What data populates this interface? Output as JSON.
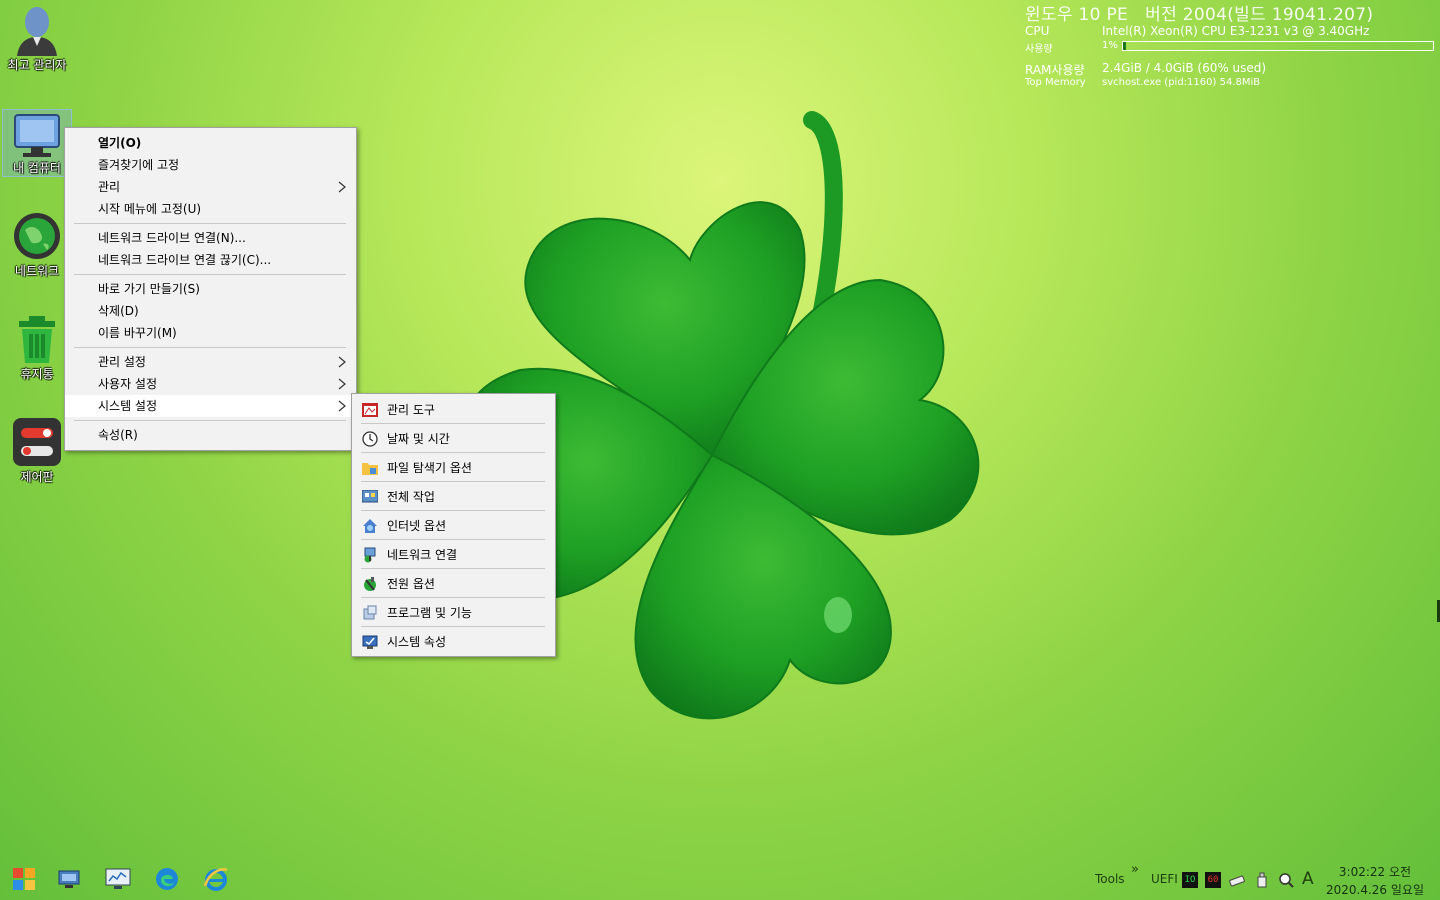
{
  "desktop": {
    "icons": [
      {
        "label": "최고 관리자",
        "icon": "admin-user-icon"
      },
      {
        "label": "내 컴퓨터",
        "icon": "my-computer-icon"
      },
      {
        "label": "네트워크",
        "icon": "network-globe-icon"
      },
      {
        "label": "휴지통",
        "icon": "recycle-bin-icon"
      },
      {
        "label": "제어판",
        "icon": "control-panel-icon"
      }
    ]
  },
  "sysinfo": {
    "title": "윈도우 10 PE   버전 2004(빌드 19041.207)",
    "cpu_label": "CPU",
    "cpu_value": "Intel(R) Xeon(R) CPU E3-1231 v3 @ 3.40GHz",
    "usage_label": "사용량",
    "usage_value": "1%",
    "usage_fraction": 0.01,
    "ram_label": "RAM사용량",
    "ram_value": "2.4GiB / 4.0GiB (60% used)",
    "topmem_label": "Top Memory",
    "topmem_value": "svchost.exe (pid:1160) 54.8MiB"
  },
  "context_menu": {
    "items": [
      {
        "label": "열기(O)"
      },
      {
        "label": "즐겨찾기에 고정"
      },
      {
        "label": "관리"
      },
      {
        "label": "시작 메뉴에 고정(U)"
      },
      {
        "label": "네트워크 드라이브 연결(N)..."
      },
      {
        "label": "네트워크 드라이브 연결 끊기(C)..."
      },
      {
        "label": "바로 가기 만들기(S)"
      },
      {
        "label": "삭제(D)"
      },
      {
        "label": "이름 바꾸기(M)"
      },
      {
        "label": "관리 설정"
      },
      {
        "label": "사용자 설정"
      },
      {
        "label": "시스템 설정"
      },
      {
        "label": "속성(R)"
      }
    ],
    "submenu_arrow": ">"
  },
  "sub_menu": {
    "items": [
      {
        "label": "관리 도구",
        "icon": "admin-tools-icon"
      },
      {
        "label": "날짜 및 시간",
        "icon": "clock-icon"
      },
      {
        "label": "파일 탐색기 옵션",
        "icon": "folder-options-icon"
      },
      {
        "label": "전체 작업",
        "icon": "all-tasks-icon"
      },
      {
        "label": "인터넷 옵션",
        "icon": "internet-options-icon"
      },
      {
        "label": "네트워크 연결",
        "icon": "network-connections-icon"
      },
      {
        "label": "전원 옵션",
        "icon": "power-options-icon"
      },
      {
        "label": "프로그램 및 기능",
        "icon": "programs-features-icon"
      },
      {
        "label": "시스템 속성",
        "icon": "system-properties-icon"
      }
    ]
  },
  "taskbar": {
    "buttons": [
      "start-icon",
      "network-monitor-icon",
      "performance-monitor-icon",
      "edge-icon",
      "internet-explorer-icon"
    ],
    "tray": {
      "tools_label": "Tools",
      "overflow": "»",
      "uefi_label": "UEFI",
      "indicator_1": "IO",
      "indicator_2": "60",
      "ime_label": "A"
    },
    "clock": {
      "time": "3:02:22 오전",
      "date": "2020.4.26 일요일"
    }
  },
  "colors": {
    "menu_bg": "#f2f2f2",
    "menu_hover": "#ffffff",
    "wallpaper_green": "#8fd446",
    "clover_green": "#1fa02a"
  }
}
